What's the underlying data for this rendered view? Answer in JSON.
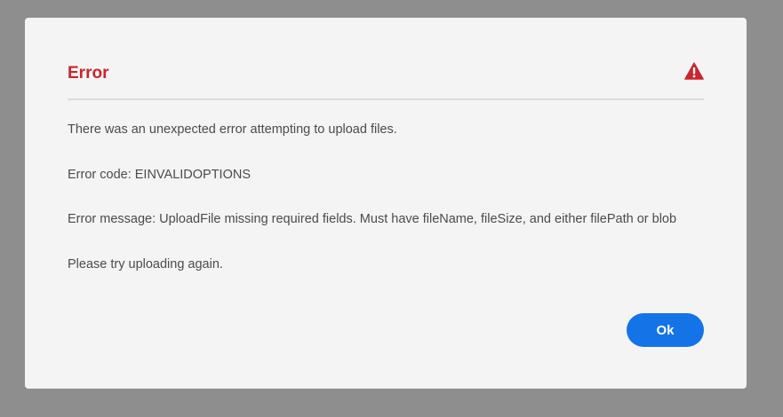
{
  "dialog": {
    "title": "Error",
    "icon": "alert-icon",
    "messages": [
      "There was an unexpected error attempting to upload files.",
      "Error code: EINVALIDOPTIONS",
      "Error message: UploadFile missing required fields. Must have fileName, fileSize, and either filePath or blob",
      "Please try uploading again."
    ],
    "ok_label": "Ok"
  },
  "colors": {
    "title": "#c9252d",
    "accent": "#1473e6",
    "backdrop": "#8e8e8e",
    "dialog_bg": "#f4f4f4"
  }
}
